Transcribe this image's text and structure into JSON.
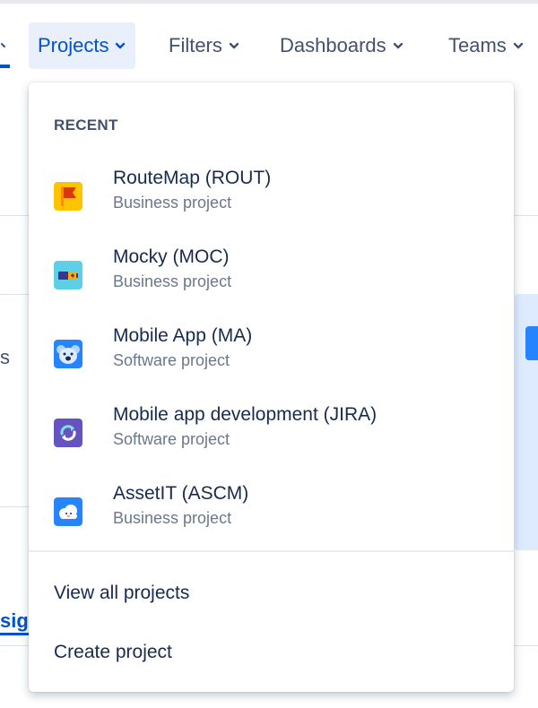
{
  "nav": {
    "items": [
      {
        "label": "Projects",
        "active": true
      },
      {
        "label": "Filters",
        "active": false
      },
      {
        "label": "Dashboards",
        "active": false
      },
      {
        "label": "Teams",
        "active": false
      }
    ]
  },
  "background": {
    "left_fragment": "s",
    "tab_fragment": "sig"
  },
  "dropdown": {
    "recent_heading": "RECENT",
    "projects": [
      {
        "name": "RouteMap (ROUT)",
        "type": "Business project",
        "icon": "flag-icon"
      },
      {
        "name": "Mocky (MOC)",
        "type": "Business project",
        "icon": "battery-icon"
      },
      {
        "name": "Mobile App (MA)",
        "type": "Software project",
        "icon": "koala-icon"
      },
      {
        "name": "Mobile app development (JIRA)",
        "type": "Software project",
        "icon": "refresh-icon"
      },
      {
        "name": "AssetIT (ASCM)",
        "type": "Business project",
        "icon": "cloud-icon"
      }
    ],
    "view_all": "View all projects",
    "create": "Create project"
  },
  "colors": {
    "accent": "#0052cc",
    "active_bg": "#e9f0fc",
    "text": "#172b4d",
    "subtext": "#6b778c"
  }
}
